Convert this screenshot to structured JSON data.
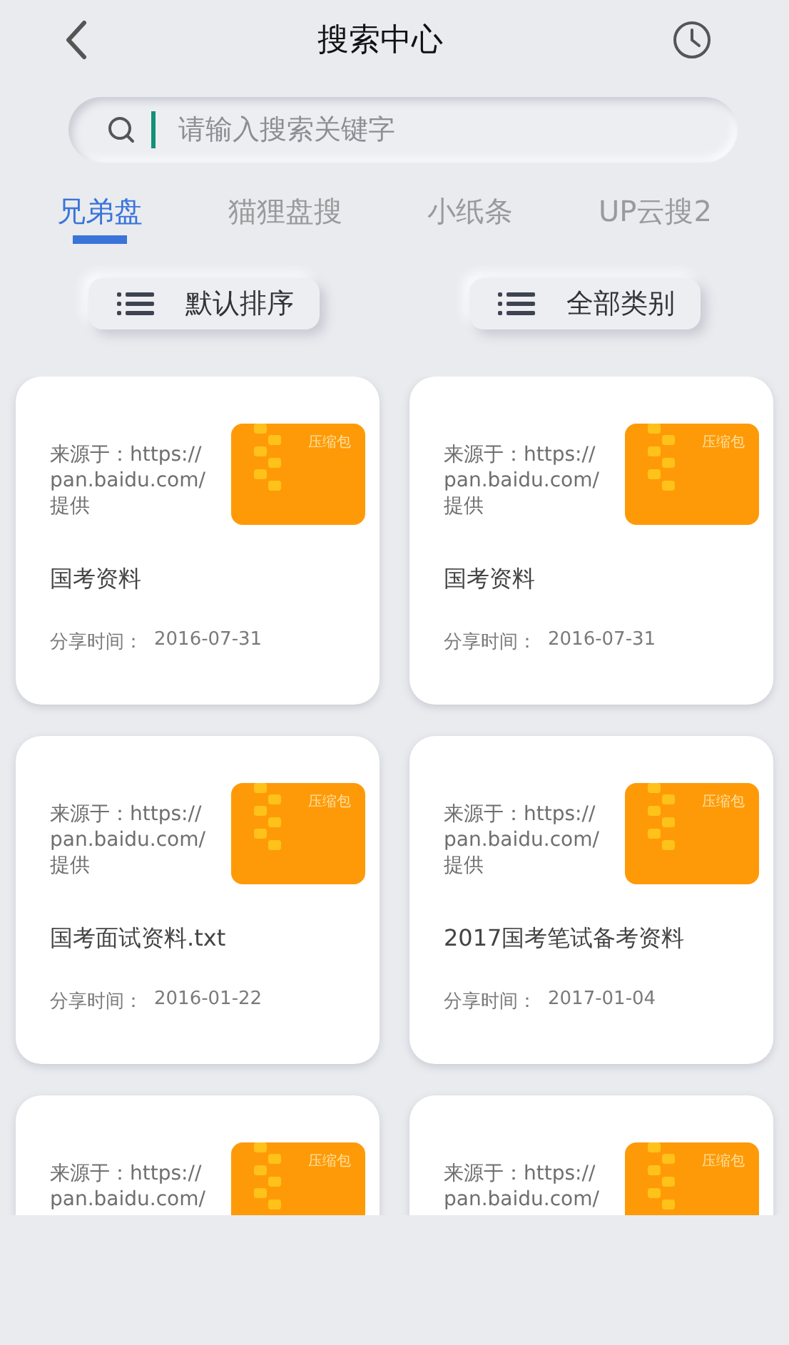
{
  "header": {
    "title": "搜索中心"
  },
  "search": {
    "placeholder": "请输入搜索关键字"
  },
  "tabs": [
    {
      "label": "兄弟盘",
      "selected": true
    },
    {
      "label": "猫狸盘搜",
      "selected": false
    },
    {
      "label": "小纸条",
      "selected": false
    },
    {
      "label": "UP云搜2",
      "selected": false
    }
  ],
  "filters": [
    "默认排序",
    "全部类别"
  ],
  "results": [
    {
      "source_lines": [
        "来源于：https://",
        "pan.baidu.com/",
        "提供"
      ],
      "badge": "压缩包",
      "name": "国考资料",
      "shared": "分享时间：",
      "date": "2016-07-31"
    },
    {
      "source_lines": [
        "来源于：https://",
        "pan.baidu.com/",
        "提供"
      ],
      "badge": "压缩包",
      "name": "国考资料",
      "shared": "分享时间：",
      "date": "2016-07-31"
    },
    {
      "source_lines": [
        "来源于：https://",
        "pan.baidu.com/",
        "提供"
      ],
      "badge": "压缩包",
      "name": "国考面试资料.txt",
      "shared": "分享时间：",
      "date": "2016-01-22"
    },
    {
      "source_lines": [
        "来源于：https://",
        "pan.baidu.com/",
        "提供"
      ],
      "badge": "压缩包",
      "name": "2017国考笔试备考资料",
      "shared": "分享时间：",
      "date": "2017-01-04"
    },
    {
      "source_lines": [
        "来源于：https://",
        "pan.baidu.com/"
      ],
      "badge": "压缩包"
    },
    {
      "source_lines": [
        "来源于：https://",
        "pan.baidu.com/"
      ],
      "badge": "压缩包"
    }
  ]
}
